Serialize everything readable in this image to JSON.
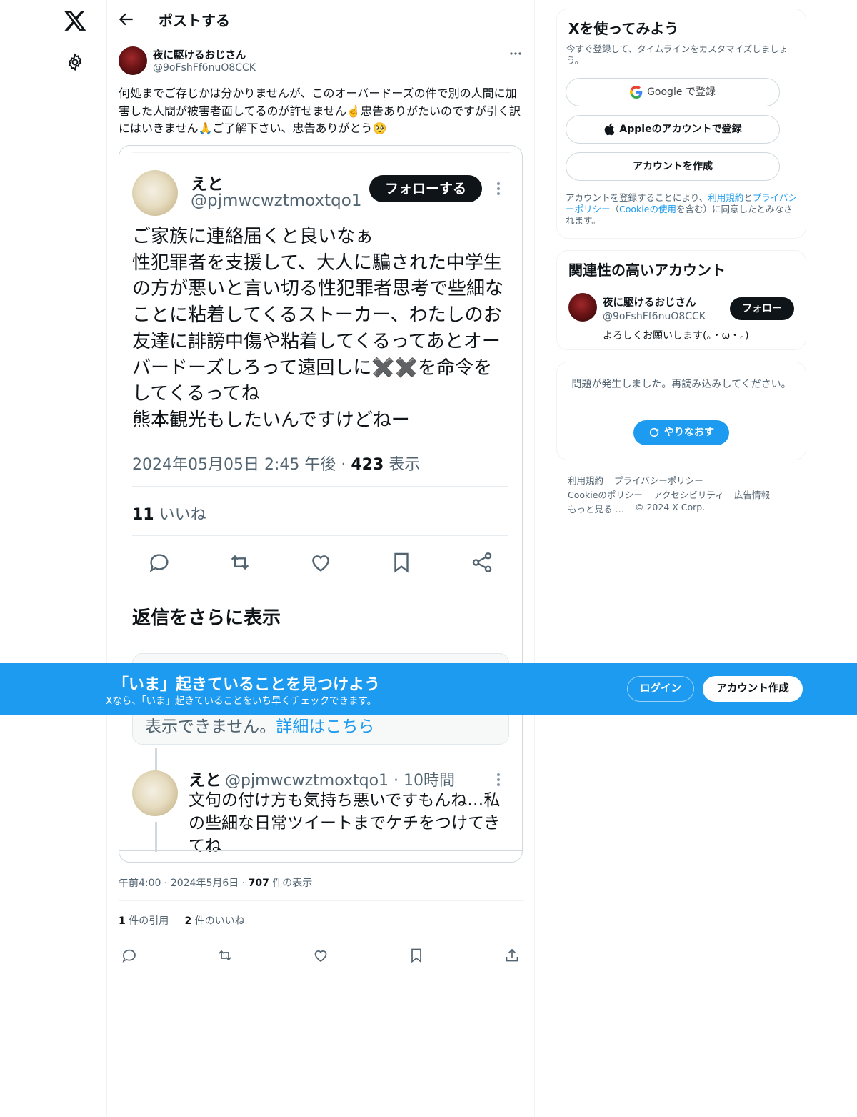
{
  "header": {
    "title": "ポストする"
  },
  "post": {
    "author_name": "夜に駆けるおじさん",
    "author_handle": "@9oFshFf6nuO8CCK",
    "text": "何処までご存じかは分かりませんが、このオーバードーズの件で別の人間に加害した人間が被害者面してるのが許せません☝️忠告ありがたいのですが引く訳にはいきません🙏ご了解下さい、忠告ありがとう🥺",
    "time": "午前4:00",
    "date": "2024年5月6日",
    "views_count": "707",
    "views_label": "件の表示",
    "quotes_count": "1",
    "quotes_label": "件の引用",
    "likes_count": "2",
    "likes_label": "件のいいね"
  },
  "embedded_image": {
    "name": "えと",
    "handle": "@pjmwcwztmoxtqo1",
    "follow_label": "フォローする",
    "body": "ご家族に連絡届くと良いなぁ\n性犯罪者を支援して、大人に騙された中学生の方が悪いと言い切る性犯罪者思考で些細なことに粘着してくるストーカー、わたしのお友達に誹謗中傷や粘着してくるってあとオーバードーズしろって遠回しに✖️✖️を命令をしてくるってね\n熊本観光もしたいんですけどねー",
    "datetime": "2024年05月05日 2:45 午後 · ",
    "views_count": "423",
    "views_label": " 表示",
    "likes_count": "11",
    "likes_label": " いいね",
    "more_replies": "返信をさらに表示",
    "unavailable_text": "表示できません。",
    "unavailable_link": "詳細はこちら",
    "reply_name": "えと",
    "reply_handle": "@pjmwcwztmoxtqo1 · 10時間",
    "reply_body": "文句の付け方も気持ち悪いですもんね…私の些細な日常ツイートまでケチをつけてきてね"
  },
  "sidebar": {
    "signup": {
      "title": "Xを使ってみよう",
      "subtitle": "今すぐ登録して、タイムラインをカスタマイズしましょう。",
      "google_label": "Google で登録",
      "apple_label": "Appleのアカウントで登録",
      "create_label": "アカウントを作成",
      "terms_prefix": "アカウントを登録することにより、",
      "terms_link": "利用規約",
      "terms_and": "と",
      "privacy_link": "プライバシーポリシー",
      "terms_mid": "（",
      "cookie_link": "Cookieの使用",
      "terms_suffix": "を含む）に同意したとみなされます。"
    },
    "related": {
      "title": "関連性の高いアカウント",
      "name": "夜に駆けるおじさん",
      "handle": "@9oFshFf6nuO8CCK",
      "bio": "よろしくお願いします(。・ω・。)",
      "follow_label": "フォロー"
    },
    "error": {
      "text": "問題が発生しました。再読み込みしてください。",
      "retry_label": "やりなおす"
    },
    "footer": {
      "terms": "利用規約",
      "privacy": "プライバシーポリシー",
      "cookie": "Cookieのポリシー",
      "accessibility": "アクセシビリティ",
      "ads": "広告情報",
      "more": "もっと見る …",
      "copyright": "© 2024 X Corp."
    }
  },
  "banner": {
    "title": "「いま」起きていることを見つけよう",
    "subtitle": "Xなら、「いま」起きていることをいち早くチェックできます。",
    "login_label": "ログイン",
    "signup_label": "アカウント作成"
  },
  "colors": {
    "accent": "#1d9bf0",
    "text": "#0f1419",
    "muted": "#536471"
  }
}
